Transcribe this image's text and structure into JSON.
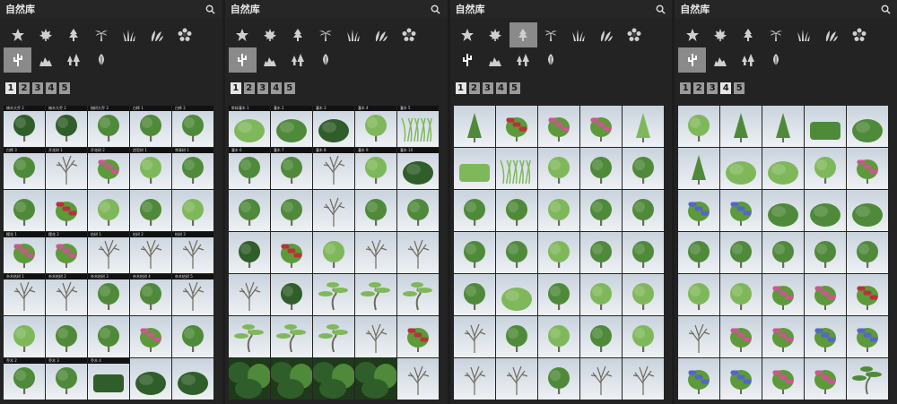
{
  "app": {
    "title": "自然库"
  },
  "colors": {
    "panel": "#232323",
    "tile_sky": "#d6dde4",
    "tree_dark": "#2f5e2a",
    "tree_mid": "#4f8a3a",
    "tree_light": "#7fb85a",
    "shrub": "#5c9a3a",
    "pink_flower": "#c65a8a",
    "red_flower": "#b8323a",
    "blue_flower": "#5566c8",
    "bare_branch": "#6f6a5e",
    "palm": "#5a8040"
  },
  "categories": [
    {
      "icon": "star-icon"
    },
    {
      "icon": "maple-leaf-icon"
    },
    {
      "icon": "conifer-tree-icon"
    },
    {
      "icon": "palm-tree-icon"
    },
    {
      "icon": "grass-icon"
    },
    {
      "icon": "leaves-icon"
    },
    {
      "icon": "flower-icon"
    },
    {
      "icon": "cactus-icon"
    },
    {
      "icon": "rocks-icon"
    },
    {
      "icon": "pine-pair-icon"
    },
    {
      "icon": "leaf-icon"
    }
  ],
  "pages": [
    "1",
    "2",
    "3",
    "4",
    "5"
  ],
  "panels": [
    {
      "active_category": 7,
      "active_page": 0,
      "tiles": [
        {
          "name": "楠木大乔 2",
          "type": "tree",
          "shade": "dark"
        },
        {
          "name": "楠木大乔 2",
          "type": "tree",
          "shade": "dark"
        },
        {
          "name": "榕树大乔 3",
          "type": "tree",
          "shade": "mid"
        },
        {
          "name": "白桦 1",
          "type": "tree",
          "shade": "mid"
        },
        {
          "name": "白桦 2",
          "type": "tree",
          "shade": "mid"
        },
        {
          "name": "白桦 3",
          "type": "tree",
          "shade": "mid"
        },
        {
          "name": "开花树 1",
          "type": "bare",
          "shade": "mid"
        },
        {
          "name": "开花树 2",
          "type": "flower",
          "shade": "pink"
        },
        {
          "name": "造型树 1",
          "type": "tree",
          "shade": "light"
        },
        {
          "name": "常青树 1",
          "type": "tree",
          "shade": "mid"
        },
        {
          "name": "",
          "type": "tree",
          "shade": "mid"
        },
        {
          "name": "",
          "type": "flower",
          "shade": "red"
        },
        {
          "name": "",
          "type": "tree",
          "shade": "light"
        },
        {
          "name": "",
          "type": "tree",
          "shade": "mid"
        },
        {
          "name": "",
          "type": "tree",
          "shade": "light"
        },
        {
          "name": "樱花 1",
          "type": "flower",
          "shade": "pink"
        },
        {
          "name": "樱花 2",
          "type": "flower",
          "shade": "pink"
        },
        {
          "name": "枯树 1",
          "type": "bare",
          "shade": "mid"
        },
        {
          "name": "枯树 2",
          "type": "bare",
          "shade": "mid"
        },
        {
          "name": "枯树 3",
          "type": "bare",
          "shade": "mid"
        },
        {
          "name": "杂木枯树 1",
          "type": "bare",
          "shade": "mid"
        },
        {
          "name": "杂木枯树 2",
          "type": "bare",
          "shade": "mid"
        },
        {
          "name": "杂木枯树 3",
          "type": "tree",
          "shade": "mid"
        },
        {
          "name": "杂木枯树 4",
          "type": "tree",
          "shade": "mid"
        },
        {
          "name": "杂木枯树 5",
          "type": "bare",
          "shade": "mid"
        },
        {
          "name": "",
          "type": "tree",
          "shade": "light"
        },
        {
          "name": "",
          "type": "tree",
          "shade": "mid"
        },
        {
          "name": "",
          "type": "tree",
          "shade": "mid"
        },
        {
          "name": "",
          "type": "flower",
          "shade": "pink"
        },
        {
          "name": "",
          "type": "tree",
          "shade": "mid"
        },
        {
          "name": "乔木 2",
          "type": "tree",
          "shade": "mid"
        },
        {
          "name": "乔木 3",
          "type": "tree",
          "shade": "mid"
        },
        {
          "name": "乔木 4",
          "type": "hedge",
          "shade": "dark"
        },
        {
          "name": "",
          "type": "shrub",
          "shade": "dark"
        },
        {
          "name": "",
          "type": "shrub",
          "shade": "dark"
        }
      ]
    },
    {
      "active_category": 7,
      "active_page": 0,
      "tiles": [
        {
          "name": "常绿灌木 1",
          "type": "shrub",
          "shade": "light"
        },
        {
          "name": "灌木 2",
          "type": "shrub",
          "shade": "mid"
        },
        {
          "name": "灌木 3",
          "type": "shrub",
          "shade": "dark"
        },
        {
          "name": "灌木 4",
          "type": "tree",
          "shade": "light"
        },
        {
          "name": "灌木 5",
          "type": "grass",
          "shade": "light"
        },
        {
          "name": "灌木 6",
          "type": "tree",
          "shade": "mid"
        },
        {
          "name": "灌木 7",
          "type": "tree",
          "shade": "mid"
        },
        {
          "name": "灌木 8",
          "type": "bare",
          "shade": "mid"
        },
        {
          "name": "灌木 9",
          "type": "tree",
          "shade": "light"
        },
        {
          "name": "灌木 10",
          "type": "shrub",
          "shade": "dark"
        },
        {
          "name": "",
          "type": "tree",
          "shade": "mid"
        },
        {
          "name": "",
          "type": "tree",
          "shade": "mid"
        },
        {
          "name": "",
          "type": "bare",
          "shade": "mid"
        },
        {
          "name": "",
          "type": "tree",
          "shade": "mid"
        },
        {
          "name": "",
          "type": "tree",
          "shade": "mid"
        },
        {
          "name": "",
          "type": "tree",
          "shade": "dark"
        },
        {
          "name": "",
          "type": "flower",
          "shade": "red"
        },
        {
          "name": "",
          "type": "tree",
          "shade": "light"
        },
        {
          "name": "",
          "type": "bare",
          "shade": "mid"
        },
        {
          "name": "",
          "type": "bare",
          "shade": "mid"
        },
        {
          "name": "",
          "type": "bare",
          "shade": "mid"
        },
        {
          "name": "",
          "type": "tree",
          "shade": "dark"
        },
        {
          "name": "",
          "type": "bonsai",
          "shade": "light"
        },
        {
          "name": "",
          "type": "bonsai",
          "shade": "light"
        },
        {
          "name": "",
          "type": "bonsai",
          "shade": "light"
        },
        {
          "name": "",
          "type": "bonsai",
          "shade": "light"
        },
        {
          "name": "",
          "type": "bonsai",
          "shade": "light"
        },
        {
          "name": "",
          "type": "bonsai",
          "shade": "light"
        },
        {
          "name": "",
          "type": "bare",
          "shade": "mid"
        },
        {
          "name": "",
          "type": "flower",
          "shade": "red"
        },
        {
          "name": "",
          "type": "forest",
          "shade": "dark"
        },
        {
          "name": "",
          "type": "forest",
          "shade": "dark"
        },
        {
          "name": "",
          "type": "forest",
          "shade": "dark"
        },
        {
          "name": "",
          "type": "forest",
          "shade": "dark"
        },
        {
          "name": "",
          "type": "bare",
          "shade": "mid"
        }
      ]
    },
    {
      "active_category": 2,
      "active_page": 0,
      "tiles": [
        {
          "name": "",
          "type": "conifer",
          "shade": "mid"
        },
        {
          "name": "",
          "type": "flower",
          "shade": "red"
        },
        {
          "name": "",
          "type": "flower",
          "shade": "pink"
        },
        {
          "name": "",
          "type": "flower",
          "shade": "pink"
        },
        {
          "name": "",
          "type": "conifer",
          "shade": "light"
        },
        {
          "name": "",
          "type": "hedge",
          "shade": "light"
        },
        {
          "name": "",
          "type": "grass",
          "shade": "light"
        },
        {
          "name": "",
          "type": "tree",
          "shade": "light"
        },
        {
          "name": "",
          "type": "tree",
          "shade": "mid"
        },
        {
          "name": "",
          "type": "tree",
          "shade": "mid"
        },
        {
          "name": "",
          "type": "tree",
          "shade": "mid"
        },
        {
          "name": "",
          "type": "tree",
          "shade": "mid"
        },
        {
          "name": "",
          "type": "tree",
          "shade": "light"
        },
        {
          "name": "",
          "type": "tree",
          "shade": "mid"
        },
        {
          "name": "",
          "type": "tree",
          "shade": "mid"
        },
        {
          "name": "",
          "type": "tree",
          "shade": "mid"
        },
        {
          "name": "",
          "type": "tree",
          "shade": "mid"
        },
        {
          "name": "",
          "type": "tree",
          "shade": "light"
        },
        {
          "name": "",
          "type": "tree",
          "shade": "mid"
        },
        {
          "name": "",
          "type": "tree",
          "shade": "mid"
        },
        {
          "name": "",
          "type": "tree",
          "shade": "mid"
        },
        {
          "name": "",
          "type": "shrub",
          "shade": "light"
        },
        {
          "name": "",
          "type": "tree",
          "shade": "mid"
        },
        {
          "name": "",
          "type": "tree",
          "shade": "light"
        },
        {
          "name": "",
          "type": "tree",
          "shade": "light"
        },
        {
          "name": "",
          "type": "bare",
          "shade": "mid"
        },
        {
          "name": "",
          "type": "tree",
          "shade": "mid"
        },
        {
          "name": "",
          "type": "tree",
          "shade": "light"
        },
        {
          "name": "",
          "type": "tree",
          "shade": "mid"
        },
        {
          "name": "",
          "type": "tree",
          "shade": "light"
        },
        {
          "name": "",
          "type": "bare",
          "shade": "mid"
        },
        {
          "name": "",
          "type": "bare",
          "shade": "mid"
        },
        {
          "name": "",
          "type": "tree",
          "shade": "mid"
        },
        {
          "name": "",
          "type": "bare",
          "shade": "mid"
        },
        {
          "name": "",
          "type": "bare",
          "shade": "mid"
        }
      ]
    },
    {
      "active_category": 7,
      "active_page": 3,
      "tiles": [
        {
          "name": "",
          "type": "tree",
          "shade": "light"
        },
        {
          "name": "",
          "type": "conifer",
          "shade": "mid"
        },
        {
          "name": "",
          "type": "conifer",
          "shade": "mid"
        },
        {
          "name": "",
          "type": "hedge",
          "shade": "mid"
        },
        {
          "name": "",
          "type": "shrub",
          "shade": "mid"
        },
        {
          "name": "",
          "type": "conifer",
          "shade": "mid"
        },
        {
          "name": "",
          "type": "shrub",
          "shade": "light"
        },
        {
          "name": "",
          "type": "shrub",
          "shade": "light"
        },
        {
          "name": "",
          "type": "tree",
          "shade": "light"
        },
        {
          "name": "",
          "type": "flower",
          "shade": "pink"
        },
        {
          "name": "",
          "type": "flower",
          "shade": "blue"
        },
        {
          "name": "",
          "type": "flower",
          "shade": "blue"
        },
        {
          "name": "",
          "type": "shrub",
          "shade": "mid"
        },
        {
          "name": "",
          "type": "shrub",
          "shade": "mid"
        },
        {
          "name": "",
          "type": "shrub",
          "shade": "mid"
        },
        {
          "name": "",
          "type": "tree",
          "shade": "mid"
        },
        {
          "name": "",
          "type": "tree",
          "shade": "mid"
        },
        {
          "name": "",
          "type": "tree",
          "shade": "mid"
        },
        {
          "name": "",
          "type": "tree",
          "shade": "mid"
        },
        {
          "name": "",
          "type": "tree",
          "shade": "mid"
        },
        {
          "name": "",
          "type": "tree",
          "shade": "light"
        },
        {
          "name": "",
          "type": "tree",
          "shade": "light"
        },
        {
          "name": "",
          "type": "flower",
          "shade": "pink"
        },
        {
          "name": "",
          "type": "flower",
          "shade": "pink"
        },
        {
          "name": "",
          "type": "flower",
          "shade": "red"
        },
        {
          "name": "",
          "type": "bare",
          "shade": "mid"
        },
        {
          "name": "",
          "type": "flower",
          "shade": "pink"
        },
        {
          "name": "",
          "type": "flower",
          "shade": "pink"
        },
        {
          "name": "",
          "type": "flower",
          "shade": "blue"
        },
        {
          "name": "",
          "type": "flower",
          "shade": "blue"
        },
        {
          "name": "",
          "type": "flower",
          "shade": "blue"
        },
        {
          "name": "",
          "type": "flower",
          "shade": "blue"
        },
        {
          "name": "",
          "type": "flower",
          "shade": "pink"
        },
        {
          "name": "",
          "type": "flower",
          "shade": "pink"
        },
        {
          "name": "",
          "type": "bonsai",
          "shade": "mid"
        }
      ]
    }
  ]
}
